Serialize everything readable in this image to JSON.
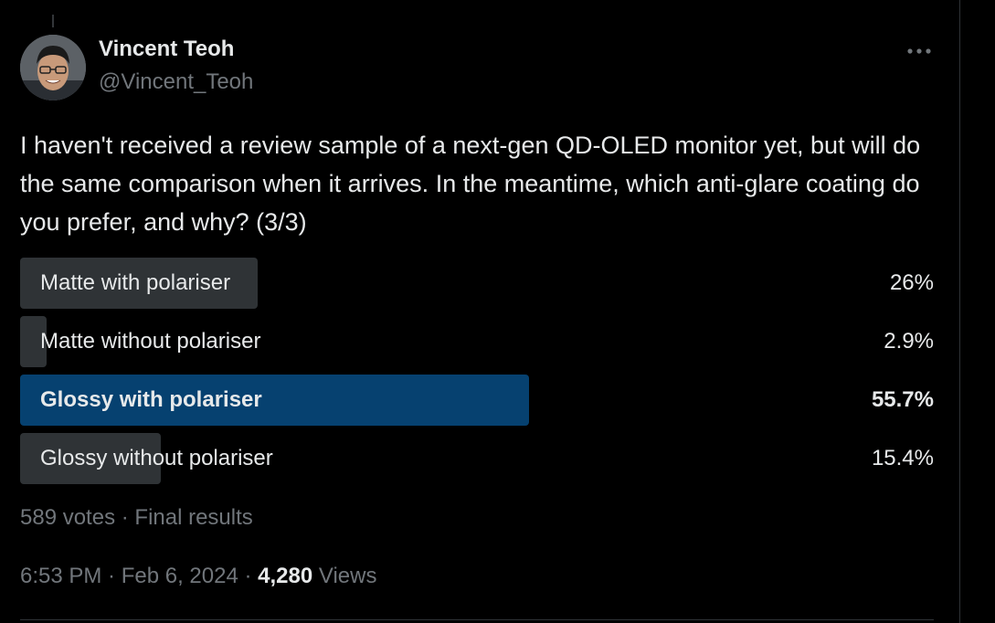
{
  "author": {
    "name": "Vincent Teoh",
    "handle": "@Vincent_Teoh"
  },
  "tweet": {
    "text": "I haven't received a review sample of a next-gen QD-OLED monitor yet, but will do the same comparison when it arrives. In the meantime, which anti-glare coating do you prefer, and why? (3/3)"
  },
  "poll": {
    "options": [
      {
        "label": "Matte with polariser",
        "percent_text": "26%",
        "percent": 26,
        "winner": false
      },
      {
        "label": "Matte without polariser",
        "percent_text": "2.9%",
        "percent": 2.9,
        "winner": false
      },
      {
        "label": "Glossy with polariser",
        "percent_text": "55.7%",
        "percent": 55.7,
        "winner": true
      },
      {
        "label": "Glossy without polariser",
        "percent_text": "15.4%",
        "percent": 15.4,
        "winner": false
      }
    ],
    "votes": "589 votes",
    "separator": " · ",
    "status": "Final results"
  },
  "meta": {
    "time": "6:53 PM",
    "date": "Feb 6, 2024",
    "views_count": "4,280",
    "views_label": "Views",
    "separator": " · "
  },
  "icons": {
    "more": "more-horizontal-icon"
  },
  "colors": {
    "background": "#000000",
    "text_primary": "#e7e9ea",
    "text_secondary": "#71767b",
    "bar_default": "#2f3336",
    "bar_winner": "#064170"
  }
}
